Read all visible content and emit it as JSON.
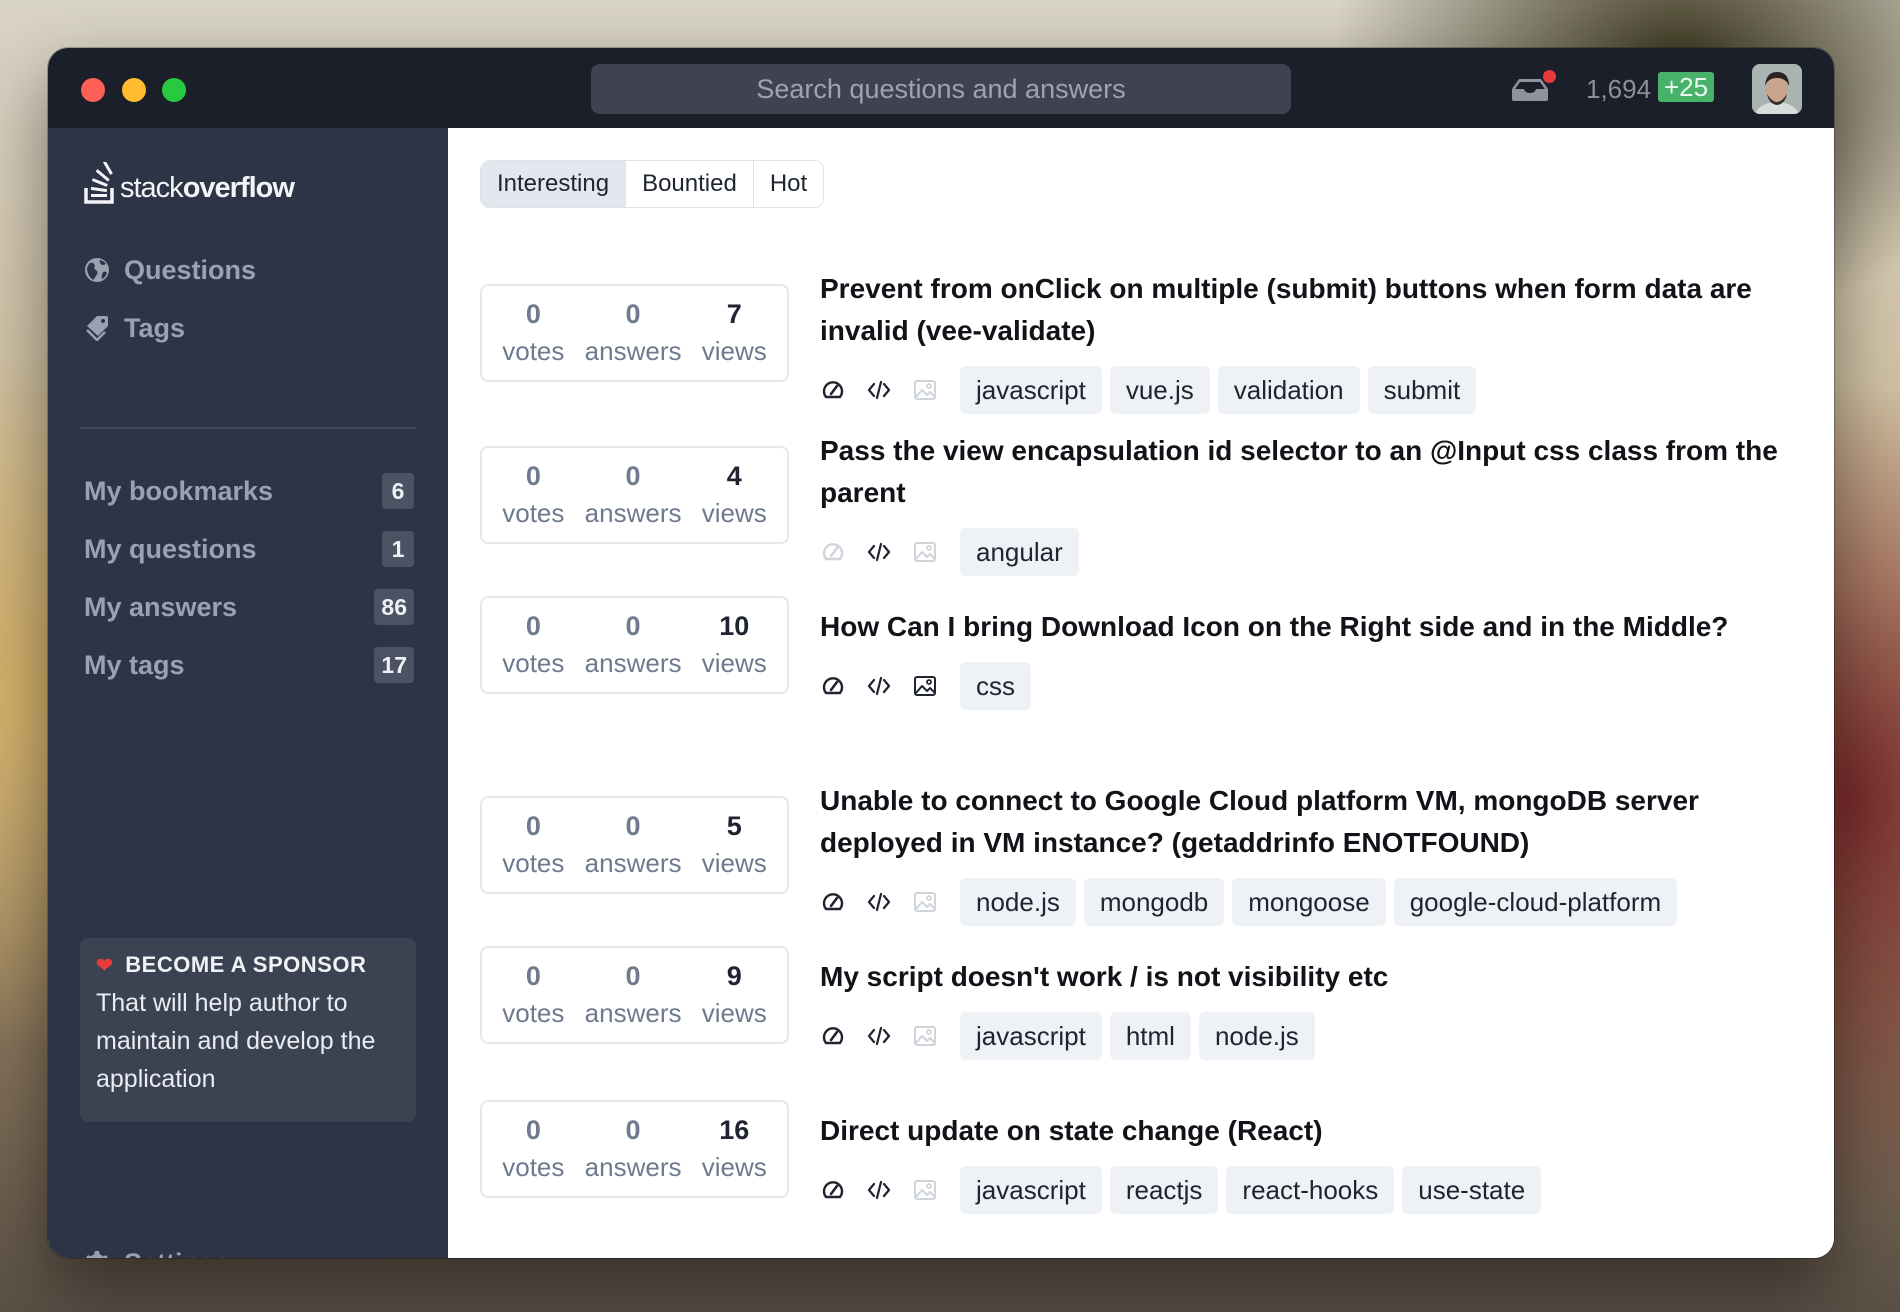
{
  "titlebar": {
    "search_placeholder": "Search questions and answers",
    "inbox_icon": "inbox-icon",
    "has_notification": true,
    "reputation": "1,694",
    "reputation_change": "+25",
    "colors": {
      "notification": "#e8393c",
      "reputation_badge": "#48b26b"
    }
  },
  "sidebar": {
    "logo": {
      "light": "stack",
      "bold": "overflow"
    },
    "nav": [
      {
        "label": "Questions",
        "icon": "globe-icon"
      },
      {
        "label": "Tags",
        "icon": "tags-icon"
      }
    ],
    "my_items": [
      {
        "label": "My bookmarks",
        "count": "6"
      },
      {
        "label": "My questions",
        "count": "1"
      },
      {
        "label": "My answers",
        "count": "86"
      },
      {
        "label": "My tags",
        "count": "17"
      }
    ],
    "sponsor": {
      "title": "BECOME A SPONSOR",
      "text": "That will help author to maintain and develop the application"
    },
    "settings_label": "Settings"
  },
  "main": {
    "tabs": [
      {
        "label": "Interesting",
        "active": true
      },
      {
        "label": "Bountied",
        "active": false
      },
      {
        "label": "Hot",
        "active": false
      }
    ],
    "stat_labels": {
      "votes": "votes",
      "answers": "answers",
      "views": "views"
    },
    "questions": [
      {
        "votes": "0",
        "answers": "0",
        "views": "7",
        "title": "Prevent from onClick on multiple (submit) buttons when form data are invalid (vee-validate)",
        "flags": {
          "performance": true,
          "code": true,
          "image": false
        },
        "tags": [
          "javascript",
          "vue.js",
          "validation",
          "submit"
        ]
      },
      {
        "votes": "0",
        "answers": "0",
        "views": "4",
        "title": "Pass the view encapsulation id selector to an @Input css class from the parent",
        "flags": {
          "performance": false,
          "code": true,
          "image": false
        },
        "tags": [
          "angular"
        ]
      },
      {
        "votes": "0",
        "answers": "0",
        "views": "10",
        "title": "How Can I bring Download Icon on the Right side and in the Middle?",
        "flags": {
          "performance": true,
          "code": true,
          "image": true
        },
        "tags": [
          "css"
        ]
      },
      {
        "votes": "0",
        "answers": "0",
        "views": "5",
        "title": "Unable to connect to Google Cloud platform VM, mongoDB server deployed in VM instance? (getaddrinfo ENOTFOUND)",
        "flags": {
          "performance": true,
          "code": true,
          "image": false
        },
        "tags": [
          "node.js",
          "mongodb",
          "mongoose",
          "google-cloud-platform"
        ]
      },
      {
        "votes": "0",
        "answers": "0",
        "views": "9",
        "title": "My script doesn't work / is not visibility etc",
        "flags": {
          "performance": true,
          "code": true,
          "image": false
        },
        "tags": [
          "javascript",
          "html",
          "node.js"
        ]
      },
      {
        "votes": "0",
        "answers": "0",
        "views": "16",
        "title": "Direct update on state change (React)",
        "flags": {
          "performance": true,
          "code": true,
          "image": false
        },
        "tags": [
          "javascript",
          "reactjs",
          "react-hooks",
          "use-state"
        ]
      }
    ]
  }
}
